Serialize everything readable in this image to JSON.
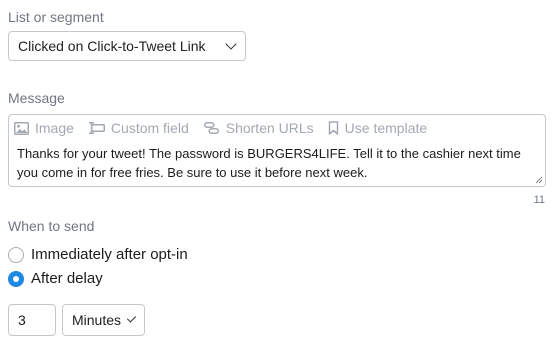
{
  "list_segment": {
    "label": "List or segment",
    "selected": "Clicked on Click-to-Tweet Link"
  },
  "message": {
    "label": "Message",
    "toolbar": [
      {
        "label": "Image",
        "icon": "image-icon"
      },
      {
        "label": "Custom field",
        "icon": "custom-field-icon"
      },
      {
        "label": "Shorten URLs",
        "icon": "link-icon"
      },
      {
        "label": "Use template",
        "icon": "bookmark-icon"
      }
    ],
    "text": "Thanks for your tweet! The password is BURGERS4LIFE. Tell it to the cashier next time you come in for free fries. Be sure to use it before next week.",
    "char_count": "11"
  },
  "when_to_send": {
    "label": "When to send",
    "options": [
      {
        "label": "Immediately after opt-in",
        "checked": false
      },
      {
        "label": "After delay",
        "checked": true
      }
    ]
  },
  "delay": {
    "value": "3",
    "unit": "Minutes"
  },
  "colors": {
    "accent": "#1e88e5",
    "label": "#6f7782",
    "toolbar": "#a3a9b0",
    "border": "#c4c8cd"
  }
}
